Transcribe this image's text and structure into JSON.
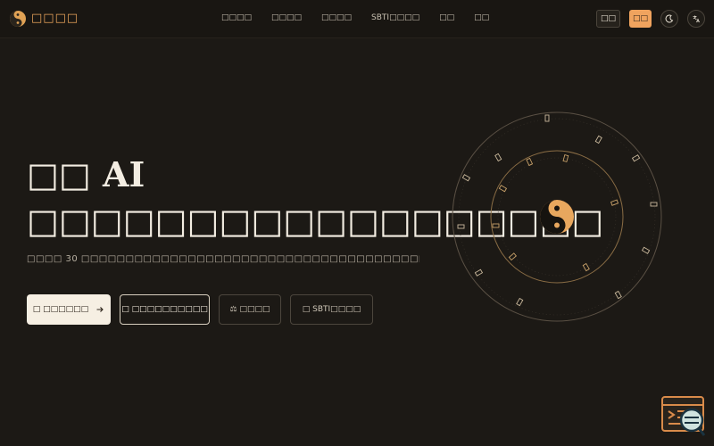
{
  "header": {
    "brand": "□□□□",
    "nav": [
      "□□□□",
      "□□□□",
      "□□□□",
      "SBTI□□□□",
      "□□",
      "□□"
    ],
    "login_label": "□□",
    "register_label": "□□",
    "theme_icon": "moon-icon",
    "language_icon": "translate-icon"
  },
  "hero": {
    "title": "□□ AI □□□□□□□□□□□□□□□□□□",
    "subtitle": "□□□□ 30 □□□□□□□□□□□□□□□□□□□□□□□□□□□□□□□□□□□□□□□□□",
    "cta": [
      {
        "label": "□ □□□□□□",
        "icon": "arrow-right-icon"
      },
      {
        "label": "□ □□□□□□□□□□"
      },
      {
        "label": "⚖ □□□□"
      },
      {
        "label": "□ SBTI□□□□"
      }
    ]
  },
  "colors": {
    "accent": "#f0a35e",
    "background": "#1c1915",
    "ring": "#c9a26a"
  }
}
